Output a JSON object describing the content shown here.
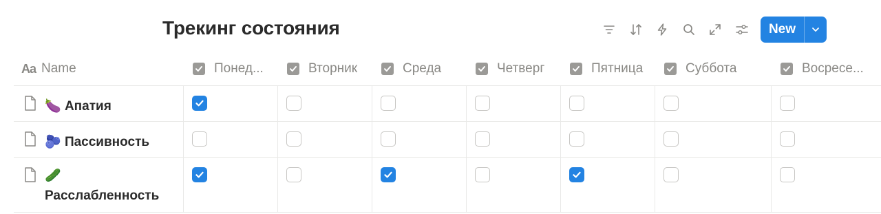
{
  "title": "Трекинг состояния",
  "toolbar": {
    "icons": [
      "filter-icon",
      "sort-icon",
      "automation-icon",
      "search-icon",
      "expand-icon",
      "settings-icon"
    ],
    "new_label": "New",
    "accent": "#2383e2"
  },
  "columns": {
    "name": "Name",
    "days": [
      "Понед...",
      "Вторник",
      "Среда",
      "Четверг",
      "Пятница",
      "Суббота",
      "Восресе..."
    ]
  },
  "rows": [
    {
      "emoji": "🍆",
      "name_line1": "Апатия",
      "name_line2": "",
      "checks": [
        true,
        false,
        false,
        false,
        false,
        false,
        false
      ]
    },
    {
      "emoji": "🫐",
      "name_line1": "Пассивность",
      "name_line2": "",
      "checks": [
        false,
        false,
        false,
        false,
        false,
        false,
        false
      ]
    },
    {
      "emoji": "🥒",
      "name_line1": "",
      "name_line2": "Расслабленность",
      "checks": [
        true,
        false,
        true,
        false,
        true,
        false,
        false
      ]
    }
  ]
}
